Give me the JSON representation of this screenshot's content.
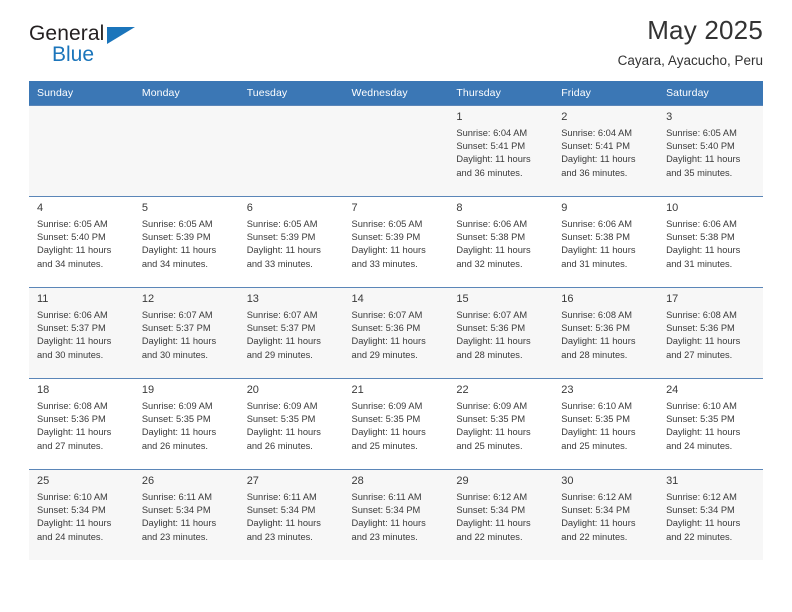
{
  "brand": {
    "name_part1": "General",
    "name_part2": "Blue",
    "accent_color": "#1b75bb",
    "triangle_icon": "triangle-logo-icon"
  },
  "header": {
    "title": "May 2025",
    "subtitle": "Cayara, Ayacucho, Peru"
  },
  "theme": {
    "header_row_bg": "#3b77b5",
    "header_row_text": "#ffffff",
    "row_alt_bg": "#f7f7f7",
    "row_bg": "#ffffff",
    "cell_border": "#5b86b8"
  },
  "weekdays": [
    "Sunday",
    "Monday",
    "Tuesday",
    "Wednesday",
    "Thursday",
    "Friday",
    "Saturday"
  ],
  "weeks": [
    [
      {
        "day": "",
        "detail": ""
      },
      {
        "day": "",
        "detail": ""
      },
      {
        "day": "",
        "detail": ""
      },
      {
        "day": "",
        "detail": ""
      },
      {
        "day": "1",
        "detail": "Sunrise: 6:04 AM\nSunset: 5:41 PM\nDaylight: 11 hours\nand 36 minutes."
      },
      {
        "day": "2",
        "detail": "Sunrise: 6:04 AM\nSunset: 5:41 PM\nDaylight: 11 hours\nand 36 minutes."
      },
      {
        "day": "3",
        "detail": "Sunrise: 6:05 AM\nSunset: 5:40 PM\nDaylight: 11 hours\nand 35 minutes."
      }
    ],
    [
      {
        "day": "4",
        "detail": "Sunrise: 6:05 AM\nSunset: 5:40 PM\nDaylight: 11 hours\nand 34 minutes."
      },
      {
        "day": "5",
        "detail": "Sunrise: 6:05 AM\nSunset: 5:39 PM\nDaylight: 11 hours\nand 34 minutes."
      },
      {
        "day": "6",
        "detail": "Sunrise: 6:05 AM\nSunset: 5:39 PM\nDaylight: 11 hours\nand 33 minutes."
      },
      {
        "day": "7",
        "detail": "Sunrise: 6:05 AM\nSunset: 5:39 PM\nDaylight: 11 hours\nand 33 minutes."
      },
      {
        "day": "8",
        "detail": "Sunrise: 6:06 AM\nSunset: 5:38 PM\nDaylight: 11 hours\nand 32 minutes."
      },
      {
        "day": "9",
        "detail": "Sunrise: 6:06 AM\nSunset: 5:38 PM\nDaylight: 11 hours\nand 31 minutes."
      },
      {
        "day": "10",
        "detail": "Sunrise: 6:06 AM\nSunset: 5:38 PM\nDaylight: 11 hours\nand 31 minutes."
      }
    ],
    [
      {
        "day": "11",
        "detail": "Sunrise: 6:06 AM\nSunset: 5:37 PM\nDaylight: 11 hours\nand 30 minutes."
      },
      {
        "day": "12",
        "detail": "Sunrise: 6:07 AM\nSunset: 5:37 PM\nDaylight: 11 hours\nand 30 minutes."
      },
      {
        "day": "13",
        "detail": "Sunrise: 6:07 AM\nSunset: 5:37 PM\nDaylight: 11 hours\nand 29 minutes."
      },
      {
        "day": "14",
        "detail": "Sunrise: 6:07 AM\nSunset: 5:36 PM\nDaylight: 11 hours\nand 29 minutes."
      },
      {
        "day": "15",
        "detail": "Sunrise: 6:07 AM\nSunset: 5:36 PM\nDaylight: 11 hours\nand 28 minutes."
      },
      {
        "day": "16",
        "detail": "Sunrise: 6:08 AM\nSunset: 5:36 PM\nDaylight: 11 hours\nand 28 minutes."
      },
      {
        "day": "17",
        "detail": "Sunrise: 6:08 AM\nSunset: 5:36 PM\nDaylight: 11 hours\nand 27 minutes."
      }
    ],
    [
      {
        "day": "18",
        "detail": "Sunrise: 6:08 AM\nSunset: 5:36 PM\nDaylight: 11 hours\nand 27 minutes."
      },
      {
        "day": "19",
        "detail": "Sunrise: 6:09 AM\nSunset: 5:35 PM\nDaylight: 11 hours\nand 26 minutes."
      },
      {
        "day": "20",
        "detail": "Sunrise: 6:09 AM\nSunset: 5:35 PM\nDaylight: 11 hours\nand 26 minutes."
      },
      {
        "day": "21",
        "detail": "Sunrise: 6:09 AM\nSunset: 5:35 PM\nDaylight: 11 hours\nand 25 minutes."
      },
      {
        "day": "22",
        "detail": "Sunrise: 6:09 AM\nSunset: 5:35 PM\nDaylight: 11 hours\nand 25 minutes."
      },
      {
        "day": "23",
        "detail": "Sunrise: 6:10 AM\nSunset: 5:35 PM\nDaylight: 11 hours\nand 25 minutes."
      },
      {
        "day": "24",
        "detail": "Sunrise: 6:10 AM\nSunset: 5:35 PM\nDaylight: 11 hours\nand 24 minutes."
      }
    ],
    [
      {
        "day": "25",
        "detail": "Sunrise: 6:10 AM\nSunset: 5:34 PM\nDaylight: 11 hours\nand 24 minutes."
      },
      {
        "day": "26",
        "detail": "Sunrise: 6:11 AM\nSunset: 5:34 PM\nDaylight: 11 hours\nand 23 minutes."
      },
      {
        "day": "27",
        "detail": "Sunrise: 6:11 AM\nSunset: 5:34 PM\nDaylight: 11 hours\nand 23 minutes."
      },
      {
        "day": "28",
        "detail": "Sunrise: 6:11 AM\nSunset: 5:34 PM\nDaylight: 11 hours\nand 23 minutes."
      },
      {
        "day": "29",
        "detail": "Sunrise: 6:12 AM\nSunset: 5:34 PM\nDaylight: 11 hours\nand 22 minutes."
      },
      {
        "day": "30",
        "detail": "Sunrise: 6:12 AM\nSunset: 5:34 PM\nDaylight: 11 hours\nand 22 minutes."
      },
      {
        "day": "31",
        "detail": "Sunrise: 6:12 AM\nSunset: 5:34 PM\nDaylight: 11 hours\nand 22 minutes."
      }
    ]
  ]
}
